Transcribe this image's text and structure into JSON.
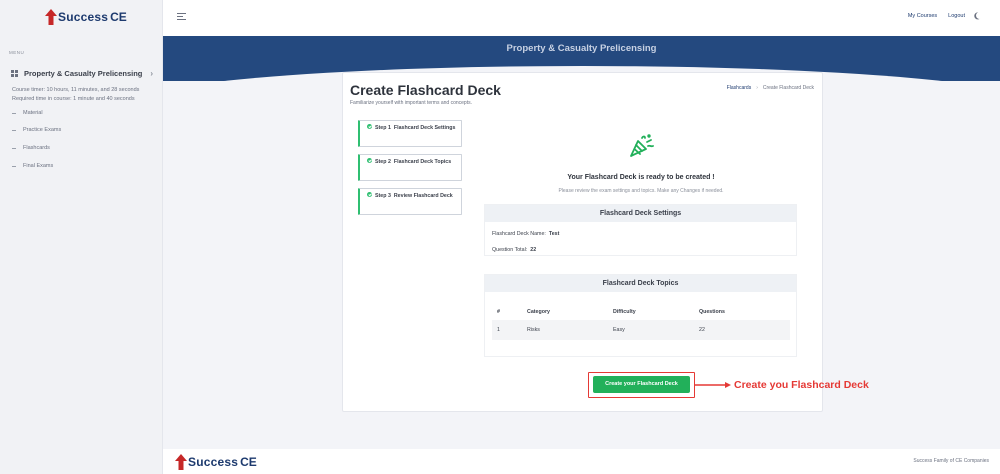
{
  "brand": {
    "name_success": "Success",
    "name_ce": "CE"
  },
  "colors": {
    "brand_navy": "#1d3a6e",
    "banner": "#24497f",
    "success_green": "#22b05a",
    "annotation_red": "#e53935"
  },
  "sidebar": {
    "menu_label": "MENU",
    "course": {
      "title": "Property & Casualty Prelicensing",
      "timer": "Course timer: 10 hours, 11 minutes, and 28 seconds",
      "required": "Required time in course: 1 minute and 40 seconds"
    },
    "items": [
      {
        "label": "Material"
      },
      {
        "label": "Practice Exams"
      },
      {
        "label": "Flashcards"
      },
      {
        "label": "Final Exams"
      }
    ]
  },
  "topbar": {
    "my_courses": "My Courses",
    "logout": "Logout",
    "theme_icon": "moon-icon"
  },
  "banner": {
    "title": "Property & Casualty Prelicensing"
  },
  "page": {
    "title": "Create Flashcard Deck",
    "subtitle": "Familiarize yourself with important terms and concepts.",
    "breadcrumb": {
      "parent": "Flashcards",
      "current": "Create Flashcard Deck"
    }
  },
  "steps": [
    {
      "num": "Step 1",
      "label": "Flashcard Deck Settings"
    },
    {
      "num": "Step 2",
      "label": "Flashcard Deck Topics"
    },
    {
      "num": "Step 3",
      "label": "Review Flashcard Deck"
    }
  ],
  "review": {
    "heading": "Your Flashcard Deck is ready to be created !",
    "subheading": "Please review the exam settings and topics. Make any Changes if needed.",
    "settings": {
      "title": "Flashcard Deck Settings",
      "name_label": "Flashcard Deck Name:",
      "name_value": "Test",
      "total_label": "Question Total:",
      "total_value": "22"
    },
    "topics": {
      "title": "Flashcard Deck Topics",
      "headers": [
        "#",
        "Category",
        "Difficulty",
        "Questions"
      ],
      "rows": [
        [
          "1",
          "Risks",
          "Easy",
          "22"
        ]
      ]
    },
    "create_button": "Create your Flashcard Deck"
  },
  "annotation": {
    "text": "Create you Flashcard Deck"
  },
  "footer": {
    "right_text": "Success Family of CE Companies"
  }
}
